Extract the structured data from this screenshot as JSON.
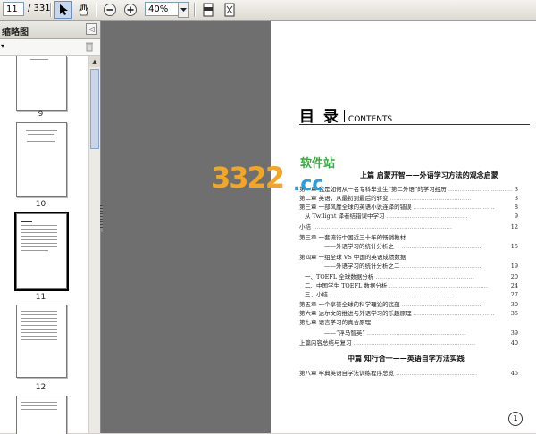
{
  "toolbar": {
    "page_current": "11",
    "page_total": "/ 331",
    "zoom": "40%"
  },
  "sidebar": {
    "title": "缩略图",
    "collapse_icon": "◁",
    "thumbnails": [
      {
        "label": "9"
      },
      {
        "label": "10"
      },
      {
        "label": "11"
      },
      {
        "label": "12"
      }
    ]
  },
  "page": {
    "heading_zh": "目 录",
    "heading_en": "CONTENTS",
    "part1": "上篇  启蒙开智——外语学习方法的观念启蒙",
    "part2": "中篇  知行合一——英语自学方法实践",
    "entries": [
      {
        "text": "第一章  我是如何从一名专科毕业生“第二外语”的学习经历",
        "num": "3"
      },
      {
        "text": "第二章  英语，从最初到最后的转变",
        "num": "3"
      },
      {
        "text": "第三章  一部风靡全球的英语小说连译的错误",
        "num": "8"
      },
      {
        "text": "从 Twilight 译者结错误中学习",
        "num": "9"
      },
      {
        "text": "小结",
        "num": "12"
      },
      {
        "text": "第三章  一套流行中国近三十年的畅销教材",
        "num": ""
      },
      {
        "text": "——外语学习的统计分析之一",
        "num": "15"
      },
      {
        "text": "第四章  一组全球 VS 中国的英语成绩数据",
        "num": ""
      },
      {
        "text": "——外语学习的统计分析之二",
        "num": "19"
      },
      {
        "text": "一、TOEFL 全球数据分析",
        "num": "20"
      },
      {
        "text": "二、中国学生 TOEFL 数据分析",
        "num": "24"
      },
      {
        "text": "三、小结",
        "num": "27"
      },
      {
        "text": "第五章  一个享誉全球的科学理论的底蕴",
        "num": "30"
      },
      {
        "text": "第六章  达尔文的推进与外语学习的乐趣原理",
        "num": "35"
      },
      {
        "text": "第七章  语言学习的真合原理",
        "num": ""
      },
      {
        "text": "——“浮马智英”",
        "num": "39"
      },
      {
        "text": "上篇内容总结与复习",
        "num": "40"
      },
      {
        "text": "第八章  牢典英语自学法训练程序总览",
        "num": "45"
      }
    ],
    "page_badge": "1"
  },
  "watermark": {
    "number": "3322",
    "suffix": ".cc",
    "site": "软件站"
  }
}
